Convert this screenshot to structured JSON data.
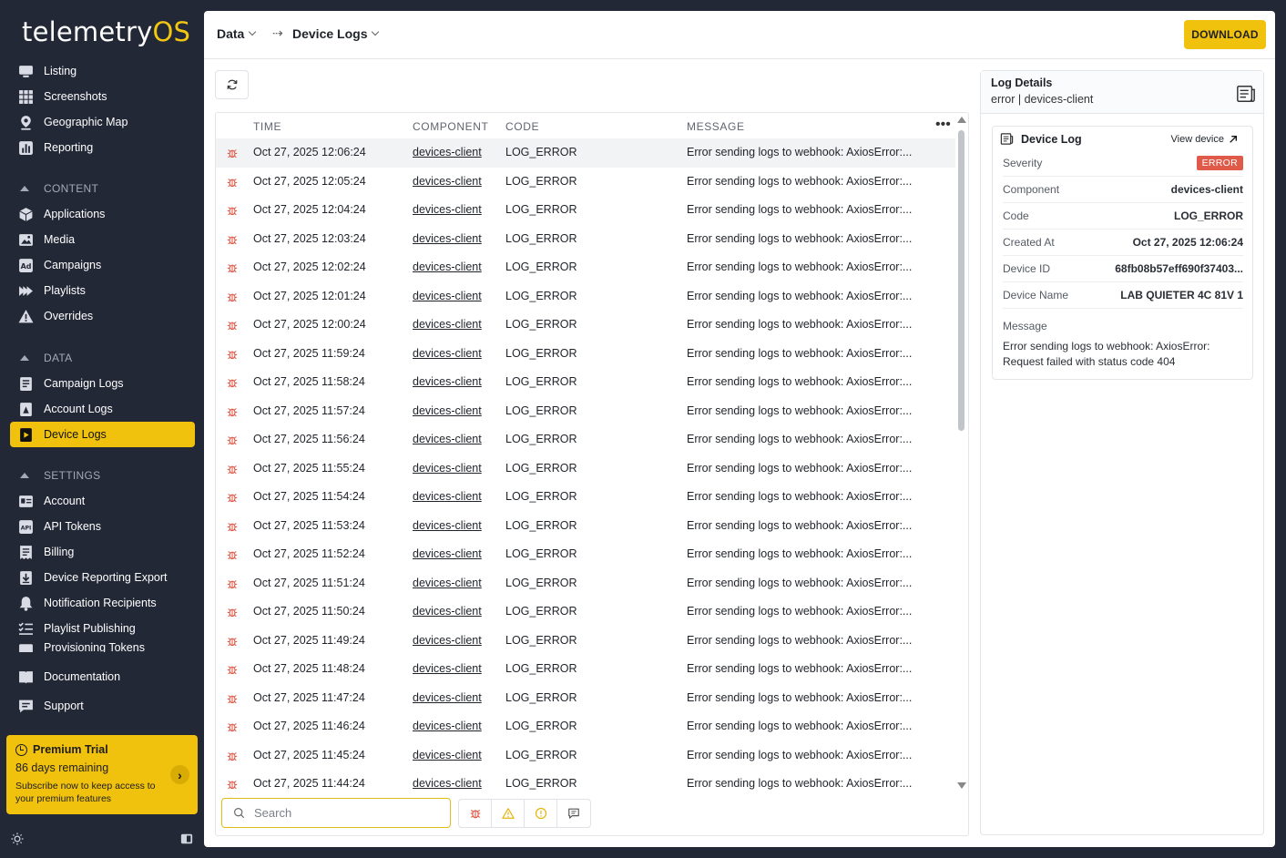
{
  "brand": {
    "name_main": "telemetry",
    "name_accent": "OS"
  },
  "sidebar": {
    "top_items": [
      {
        "label": "Listing",
        "icon": "monitor-icon"
      },
      {
        "label": "Screenshots",
        "icon": "grid-icon"
      },
      {
        "label": "Geographic Map",
        "icon": "map-pin-icon"
      },
      {
        "label": "Reporting",
        "icon": "bar-chart-icon"
      }
    ],
    "content_label": "CONTENT",
    "content_items": [
      {
        "label": "Applications",
        "icon": "cube-icon"
      },
      {
        "label": "Media",
        "icon": "image-icon"
      },
      {
        "label": "Campaigns",
        "icon": "ad-icon"
      },
      {
        "label": "Playlists",
        "icon": "playlist-icon"
      },
      {
        "label": "Overrides",
        "icon": "warning-icon"
      }
    ],
    "data_label": "DATA",
    "data_items": [
      {
        "label": "Campaign Logs",
        "icon": "campaign-log-icon"
      },
      {
        "label": "Account Logs",
        "icon": "account-log-icon"
      },
      {
        "label": "Device Logs",
        "icon": "device-log-icon",
        "active": true
      }
    ],
    "settings_label": "SETTINGS",
    "settings_items": [
      {
        "label": "Account",
        "icon": "id-card-icon"
      },
      {
        "label": "API Tokens",
        "icon": "api-icon"
      },
      {
        "label": "Billing",
        "icon": "invoice-icon"
      },
      {
        "label": "Device Reporting Export",
        "icon": "download-icon"
      },
      {
        "label": "Notification Recipients",
        "icon": "bell-icon"
      },
      {
        "label": "Playlist Publishing",
        "icon": "checklist-icon"
      },
      {
        "label": "Provisioning Tokens",
        "icon": "token-icon"
      }
    ],
    "bottom_items": [
      {
        "label": "Documentation",
        "icon": "book-icon"
      },
      {
        "label": "Support",
        "icon": "chat-icon"
      }
    ],
    "promo": {
      "title": "Premium Trial",
      "days": "86 days remaining",
      "subtitle": "Subscribe now to keep access to your premium features"
    }
  },
  "header": {
    "crumb_1": "Data",
    "crumb_2": "Device Logs",
    "download_label": "DOWNLOAD"
  },
  "table": {
    "columns": {
      "time": "TIME",
      "component": "COMPONENT",
      "code": "CODE",
      "message": "MESSAGE"
    },
    "rows": [
      {
        "time": "Oct 27, 2025 12:06:24",
        "component": "devices-client",
        "code": "LOG_ERROR",
        "message": "Error sending logs to webhook: AxiosError:..."
      },
      {
        "time": "Oct 27, 2025 12:05:24",
        "component": "devices-client",
        "code": "LOG_ERROR",
        "message": "Error sending logs to webhook: AxiosError:..."
      },
      {
        "time": "Oct 27, 2025 12:04:24",
        "component": "devices-client",
        "code": "LOG_ERROR",
        "message": "Error sending logs to webhook: AxiosError:..."
      },
      {
        "time": "Oct 27, 2025 12:03:24",
        "component": "devices-client",
        "code": "LOG_ERROR",
        "message": "Error sending logs to webhook: AxiosError:..."
      },
      {
        "time": "Oct 27, 2025 12:02:24",
        "component": "devices-client",
        "code": "LOG_ERROR",
        "message": "Error sending logs to webhook: AxiosError:..."
      },
      {
        "time": "Oct 27, 2025 12:01:24",
        "component": "devices-client",
        "code": "LOG_ERROR",
        "message": "Error sending logs to webhook: AxiosError:..."
      },
      {
        "time": "Oct 27, 2025 12:00:24",
        "component": "devices-client",
        "code": "LOG_ERROR",
        "message": "Error sending logs to webhook: AxiosError:..."
      },
      {
        "time": "Oct 27, 2025 11:59:24",
        "component": "devices-client",
        "code": "LOG_ERROR",
        "message": "Error sending logs to webhook: AxiosError:..."
      },
      {
        "time": "Oct 27, 2025 11:58:24",
        "component": "devices-client",
        "code": "LOG_ERROR",
        "message": "Error sending logs to webhook: AxiosError:..."
      },
      {
        "time": "Oct 27, 2025 11:57:24",
        "component": "devices-client",
        "code": "LOG_ERROR",
        "message": "Error sending logs to webhook: AxiosError:..."
      },
      {
        "time": "Oct 27, 2025 11:56:24",
        "component": "devices-client",
        "code": "LOG_ERROR",
        "message": "Error sending logs to webhook: AxiosError:..."
      },
      {
        "time": "Oct 27, 2025 11:55:24",
        "component": "devices-client",
        "code": "LOG_ERROR",
        "message": "Error sending logs to webhook: AxiosError:..."
      },
      {
        "time": "Oct 27, 2025 11:54:24",
        "component": "devices-client",
        "code": "LOG_ERROR",
        "message": "Error sending logs to webhook: AxiosError:..."
      },
      {
        "time": "Oct 27, 2025 11:53:24",
        "component": "devices-client",
        "code": "LOG_ERROR",
        "message": "Error sending logs to webhook: AxiosError:..."
      },
      {
        "time": "Oct 27, 2025 11:52:24",
        "component": "devices-client",
        "code": "LOG_ERROR",
        "message": "Error sending logs to webhook: AxiosError:..."
      },
      {
        "time": "Oct 27, 2025 11:51:24",
        "component": "devices-client",
        "code": "LOG_ERROR",
        "message": "Error sending logs to webhook: AxiosError:..."
      },
      {
        "time": "Oct 27, 2025 11:50:24",
        "component": "devices-client",
        "code": "LOG_ERROR",
        "message": "Error sending logs to webhook: AxiosError:..."
      },
      {
        "time": "Oct 27, 2025 11:49:24",
        "component": "devices-client",
        "code": "LOG_ERROR",
        "message": "Error sending logs to webhook: AxiosError:..."
      },
      {
        "time": "Oct 27, 2025 11:48:24",
        "component": "devices-client",
        "code": "LOG_ERROR",
        "message": "Error sending logs to webhook: AxiosError:..."
      },
      {
        "time": "Oct 27, 2025 11:47:24",
        "component": "devices-client",
        "code": "LOG_ERROR",
        "message": "Error sending logs to webhook: AxiosError:..."
      },
      {
        "time": "Oct 27, 2025 11:46:24",
        "component": "devices-client",
        "code": "LOG_ERROR",
        "message": "Error sending logs to webhook: AxiosError:..."
      },
      {
        "time": "Oct 27, 2025 11:45:24",
        "component": "devices-client",
        "code": "LOG_ERROR",
        "message": "Error sending logs to webhook: AxiosError:..."
      },
      {
        "time": "Oct 27, 2025 11:44:24",
        "component": "devices-client",
        "code": "LOG_ERROR",
        "message": "Error sending logs to webhook: AxiosError:..."
      }
    ]
  },
  "search": {
    "placeholder": "Search"
  },
  "details": {
    "title": "Log Details",
    "subtitle_level": "error",
    "subtitle_component": "devices-client",
    "card_title": "Device Log",
    "view_device": "View device",
    "fields": [
      {
        "key": "Severity",
        "value": "ERROR",
        "badge": true
      },
      {
        "key": "Component",
        "value": "devices-client"
      },
      {
        "key": "Code",
        "value": "LOG_ERROR"
      },
      {
        "key": "Created At",
        "value": "Oct 27, 2025 12:06:24"
      },
      {
        "key": "Device ID",
        "value": "68fb08b57eff690f37403..."
      },
      {
        "key": "Device Name",
        "value": "LAB QUIETER 4C 81V 1"
      }
    ],
    "message_key": "Message",
    "message_value": "Error sending logs to webhook: AxiosError: Request failed with status code 404"
  },
  "colors": {
    "accent": "#f0c20e",
    "sidebar_bg": "#232837",
    "error": "#e05a49"
  }
}
